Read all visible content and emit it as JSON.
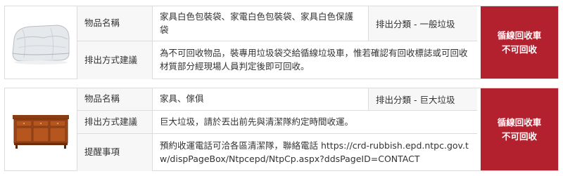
{
  "items": [
    {
      "image": "white-sofa-in-plastic-bag",
      "name_label": "物品名稱",
      "name": "家具白色包裝袋、家電白色包裝袋、家具白色保護袋",
      "category": "排出分類 - 一般垃圾",
      "method_label": "排出方式建議",
      "method": "為不可回收物品，裝專用垃圾袋交給循線垃圾車，惟若確認有回收標誌或可回收材質部分經現場人員判定後即可回收。",
      "status_line1": "循線回收車",
      "status_line2": "不可回收"
    },
    {
      "image": "wooden-cabinet",
      "name_label": "物品名稱",
      "name": "家具、傢俱",
      "category": "排出分類 - 巨大垃圾",
      "method_label": "排出方式建議",
      "method": "巨大垃圾，請於丟出前先與清潔隊約定時間收運。",
      "reminder_label": "提醒事項",
      "reminder": "預約收運電話可洽各區清潔隊，聯絡電話 https://crd-rubbish.epd.ntpc.gov.tw/dispPageBox/Ntpcepd/NtpCp.aspx?ddsPageID=CONTACT",
      "status_line1": "循線回收車",
      "status_line2": "不可回收"
    }
  ],
  "colors": {
    "status_bg": "#b3202e",
    "label_bg": "#f7f7f7",
    "border": "#dcdcdc"
  }
}
